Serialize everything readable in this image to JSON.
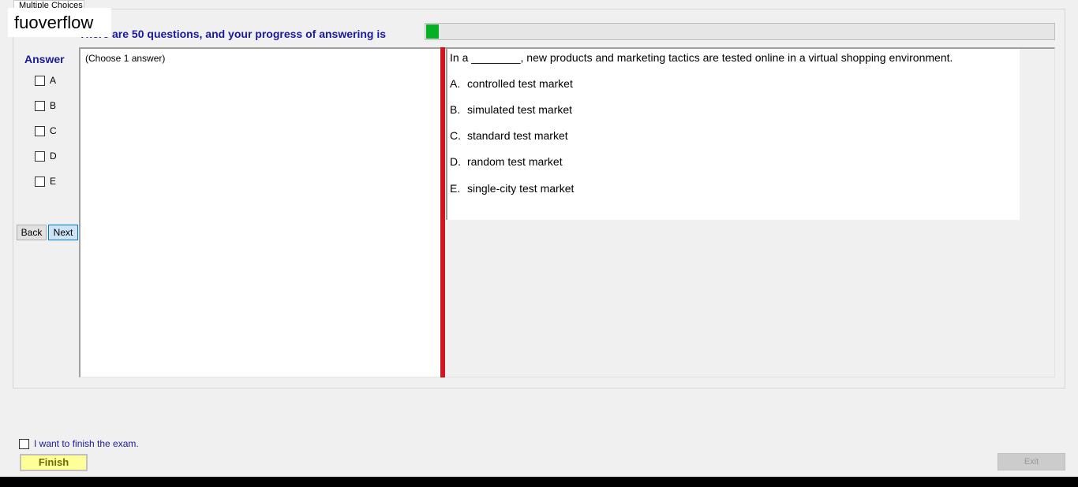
{
  "tab": {
    "label": "Multiple Choices"
  },
  "watermark": "fuoverflow",
  "progress": {
    "text": "There are 50 questions, and your progress of answering is",
    "fraction": 0.02,
    "color": "#06b025"
  },
  "answer_panel": {
    "title": "Answer",
    "options": [
      "A",
      "B",
      "C",
      "D",
      "E"
    ],
    "back_label": "Back",
    "next_label": "Next"
  },
  "answer_note": "(Choose 1 answer)",
  "question": {
    "stem": "In a ________, new products and marketing tactics are tested online in a virtual shopping environment.",
    "choices": [
      {
        "letter": "A.",
        "text": "controlled test market"
      },
      {
        "letter": "B.",
        "text": "simulated test market"
      },
      {
        "letter": "C.",
        "text": "standard test market"
      },
      {
        "letter": "D.",
        "text": "random test market"
      },
      {
        "letter": "E.",
        "text": "single-city test market"
      }
    ]
  },
  "footer": {
    "finish_check_label": "I want to finish the exam.",
    "finish_label": "Finish",
    "exit_label": "Exit"
  },
  "colors": {
    "heading": "#1a1a9c",
    "splitter": "#d2161e",
    "finish_bg": "#ffff99"
  }
}
